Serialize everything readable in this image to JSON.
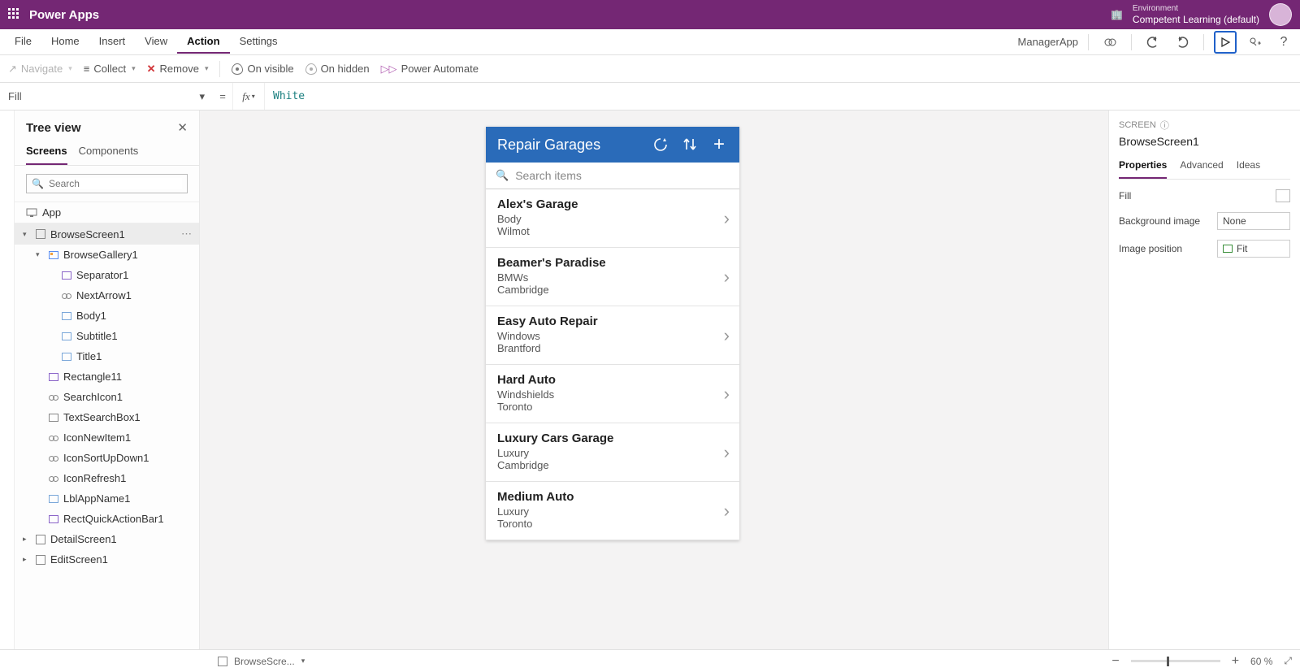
{
  "titlebar": {
    "app_name": "Power Apps",
    "env_label": "Environment",
    "env_name": "Competent Learning (default)"
  },
  "menubar": {
    "items": [
      "File",
      "Home",
      "Insert",
      "View",
      "Action",
      "Settings"
    ],
    "active_index": 4,
    "app_label": "ManagerApp"
  },
  "actionbar": {
    "navigate": "Navigate",
    "collect": "Collect",
    "remove": "Remove",
    "on_visible": "On visible",
    "on_hidden": "On hidden",
    "power_automate": "Power Automate"
  },
  "formula": {
    "prop": "Fill",
    "value": "White"
  },
  "tree": {
    "title": "Tree view",
    "tabs": [
      "Screens",
      "Components"
    ],
    "active_tab": 0,
    "search_ph": "Search",
    "app_label": "App",
    "screens": [
      {
        "name": "BrowseScreen1",
        "expanded": true,
        "selected": true,
        "children": [
          {
            "name": "BrowseGallery1",
            "type": "gallery",
            "expanded": true,
            "children": [
              {
                "name": "Separator1",
                "type": "ctrl"
              },
              {
                "name": "NextArrow1",
                "type": "ctlicon"
              },
              {
                "name": "Body1",
                "type": "txt"
              },
              {
                "name": "Subtitle1",
                "type": "txt"
              },
              {
                "name": "Title1",
                "type": "txt"
              }
            ]
          },
          {
            "name": "Rectangle11",
            "type": "ctrl"
          },
          {
            "name": "SearchIcon1",
            "type": "ctlicon"
          },
          {
            "name": "TextSearchBox1",
            "type": "input"
          },
          {
            "name": "IconNewItem1",
            "type": "ctlicon"
          },
          {
            "name": "IconSortUpDown1",
            "type": "ctlicon"
          },
          {
            "name": "IconRefresh1",
            "type": "ctlicon"
          },
          {
            "name": "LblAppName1",
            "type": "txt"
          },
          {
            "name": "RectQuickActionBar1",
            "type": "ctrl"
          }
        ]
      },
      {
        "name": "DetailScreen1",
        "expanded": false
      },
      {
        "name": "EditScreen1",
        "expanded": false
      }
    ]
  },
  "canvas": {
    "header_title": "Repair Garages",
    "search_ph": "Search items",
    "items": [
      {
        "title": "Alex's Garage",
        "sub1": "Body",
        "sub2": "Wilmot"
      },
      {
        "title": "Beamer's Paradise",
        "sub1": "BMWs",
        "sub2": "Cambridge"
      },
      {
        "title": "Easy Auto Repair",
        "sub1": "Windows",
        "sub2": "Brantford"
      },
      {
        "title": "Hard Auto",
        "sub1": "Windshields",
        "sub2": "Toronto"
      },
      {
        "title": "Luxury Cars Garage",
        "sub1": "Luxury",
        "sub2": "Cambridge"
      },
      {
        "title": "Medium Auto",
        "sub1": "Luxury",
        "sub2": "Toronto"
      }
    ]
  },
  "props": {
    "section_label": "SCREEN",
    "screen_name": "BrowseScreen1",
    "tabs": [
      "Properties",
      "Advanced",
      "Ideas"
    ],
    "active_tab": 0,
    "fill_label": "Fill",
    "bg_label": "Background image",
    "bg_value": "None",
    "imgpos_label": "Image position",
    "imgpos_value": "Fit"
  },
  "status": {
    "screen_label": "BrowseScre...",
    "zoom": "60 %"
  }
}
